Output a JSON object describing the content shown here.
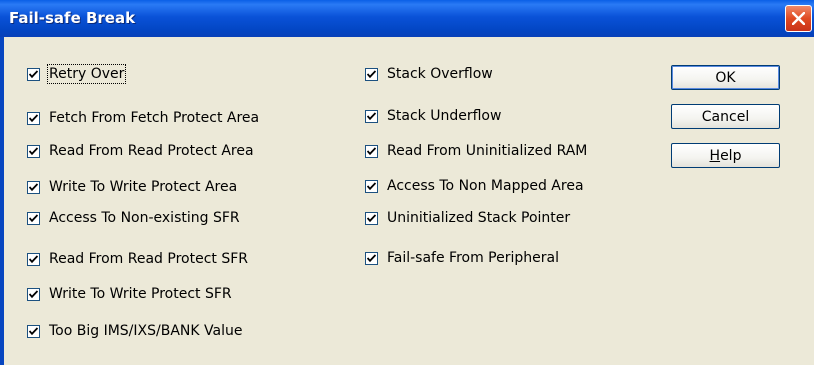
{
  "window": {
    "title": "Fail-safe Break",
    "colors": {
      "titlebar": "#0a52d8",
      "close": "#e04a22",
      "face": "#ece9d8"
    }
  },
  "checks": [
    {
      "label": "Retry Over",
      "checked": true
    },
    {
      "label": "Fetch From Fetch Protect Area",
      "checked": true
    },
    {
      "label": "Read From Read Protect Area",
      "checked": true
    },
    {
      "label": "Write To Write Protect Area",
      "checked": true
    },
    {
      "label": "Access To Non-existing SFR",
      "checked": true
    },
    {
      "label": "Read From Read Protect SFR",
      "checked": true
    },
    {
      "label": "Write To Write Protect SFR",
      "checked": true
    },
    {
      "label": "Too Big IMS/IXS/BANK Value",
      "checked": true
    },
    {
      "label": "Stack Overflow",
      "checked": true
    },
    {
      "label": "Stack Underflow",
      "checked": true
    },
    {
      "label": "Read From Uninitialized RAM",
      "checked": true
    },
    {
      "label": "Access To Non Mapped Area",
      "checked": true
    },
    {
      "label": "Uninitialized Stack Pointer",
      "checked": true
    },
    {
      "label": "Fail-safe From Peripheral",
      "checked": true
    }
  ],
  "buttons": {
    "ok": "OK",
    "cancel": "Cancel",
    "help_mnemonic": "H",
    "help_rest": "elp"
  }
}
